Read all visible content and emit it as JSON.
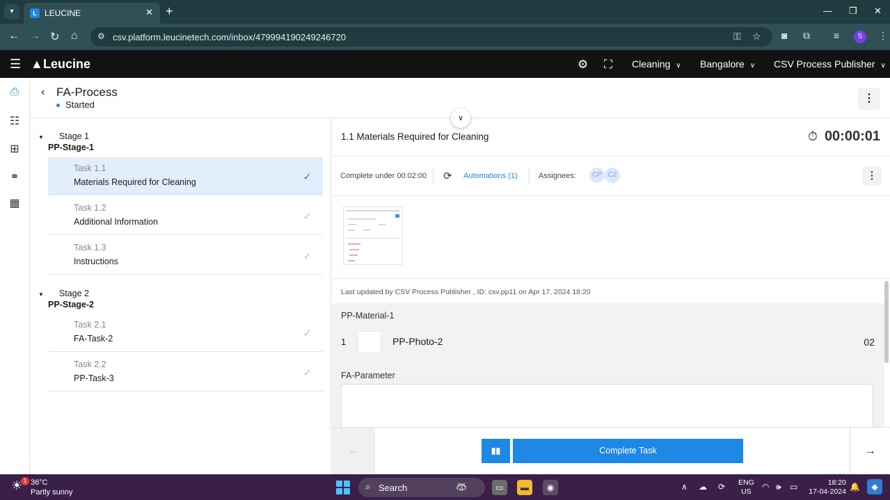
{
  "browser": {
    "tab_title": "LEUCINE",
    "url": "csv.platform.leucinetech.com/inbox/479994190249246720",
    "profile_initial": "S"
  },
  "app": {
    "brand": "Leucine",
    "use_case": "Cleaning",
    "facility": "Bangalore",
    "user": "CSV Process Publisher"
  },
  "process": {
    "name": "FA-Process",
    "status": "Started"
  },
  "stages": [
    {
      "name": "Stage 1",
      "code": "PP-Stage-1",
      "tasks": [
        {
          "number": "Task 1.1",
          "name": "Materials Required for Cleaning",
          "active": true
        },
        {
          "number": "Task 1.2",
          "name": "Additional Information"
        },
        {
          "number": "Task 1.3",
          "name": "Instructions"
        }
      ]
    },
    {
      "name": "Stage 2",
      "code": "PP-Stage-2",
      "tasks": [
        {
          "number": "Task 2.1",
          "name": "FA-Task-2"
        },
        {
          "number": "Task 2.2",
          "name": "PP-Task-3"
        }
      ]
    }
  ],
  "task": {
    "title": "1.1 Materials Required for Cleaning",
    "timer": "00:00:01",
    "complete_under": "Complete under 00:02:00",
    "automations": "Automations (1)",
    "assignees_label": "Assignees:",
    "assignees": [
      "CP",
      "C2"
    ],
    "last_updated": "Last updated by CSV Process Publisher , ID: csv.pp11 on Apr 17, 2024 18:20",
    "material_label": "PP-Material-1",
    "material_row": {
      "index": "1",
      "name": "PP-Photo-2",
      "quantity": "02"
    },
    "parameter_label": "FA-Parameter",
    "complete_button": "Complete Task"
  },
  "taskbar": {
    "weather_badge": "1",
    "temperature": "36°C",
    "condition": "Partly sunny",
    "search": "Search",
    "lang_1": "ENG",
    "lang_2": "US",
    "time": "18:20",
    "date": "17-04-2024"
  },
  "colors": {
    "accent": "#1e88e5",
    "header_bg": "#121212",
    "active_task_bg": "#e3eefc",
    "browser_bg": "#1f3b3f",
    "taskbar_bg": "#3a2049"
  }
}
